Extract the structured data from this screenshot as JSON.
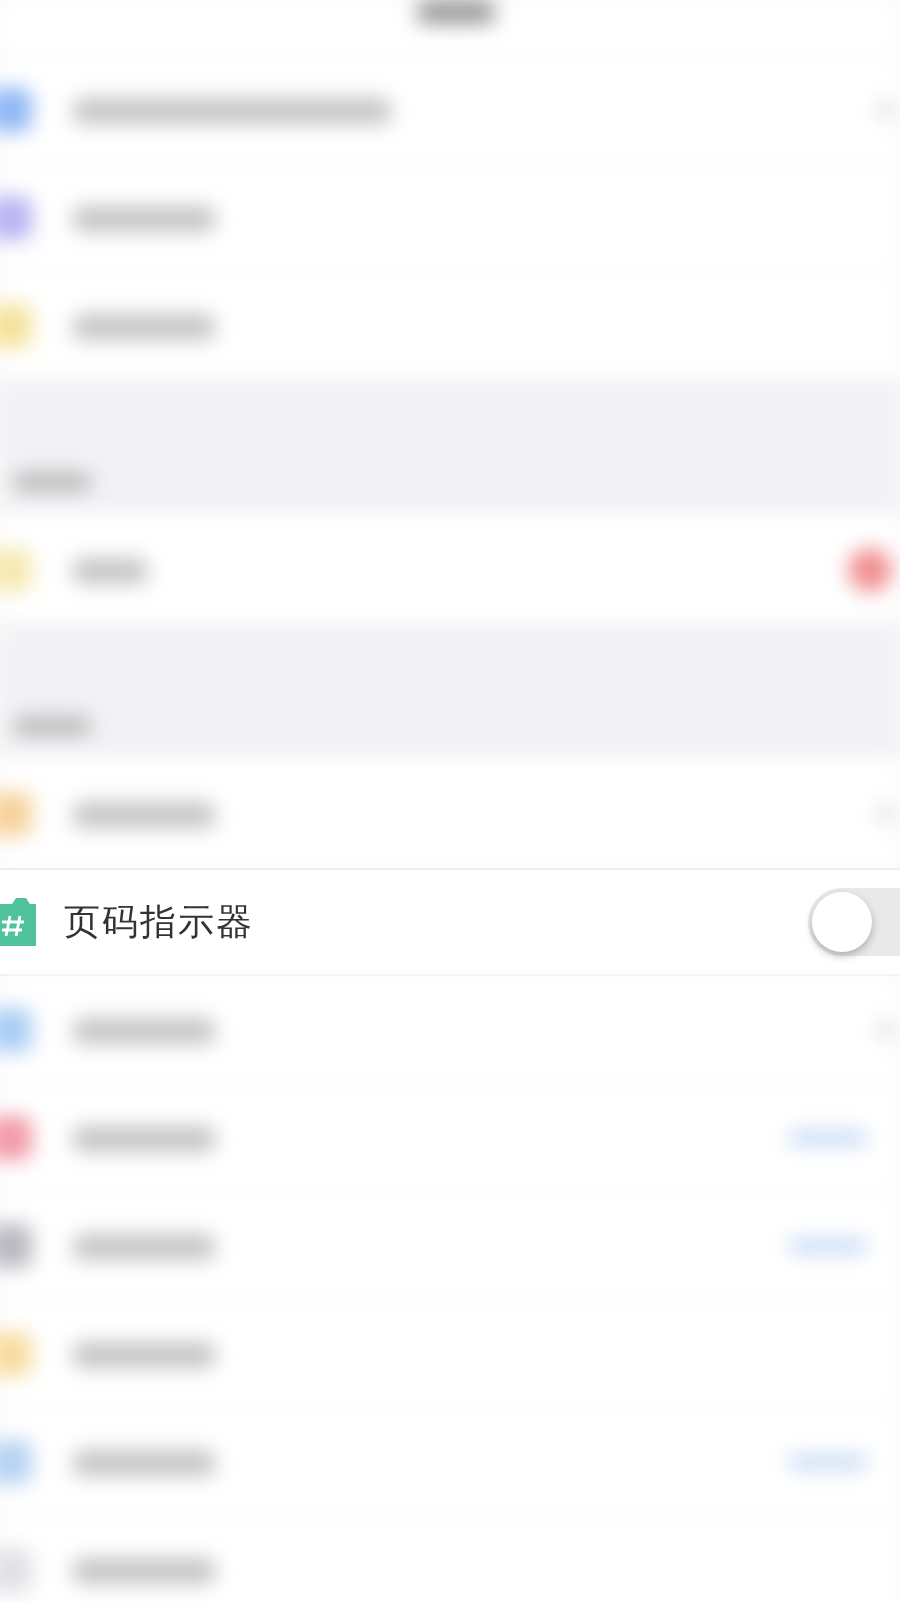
{
  "focused_row": {
    "label": "页码指示器",
    "on": false
  }
}
